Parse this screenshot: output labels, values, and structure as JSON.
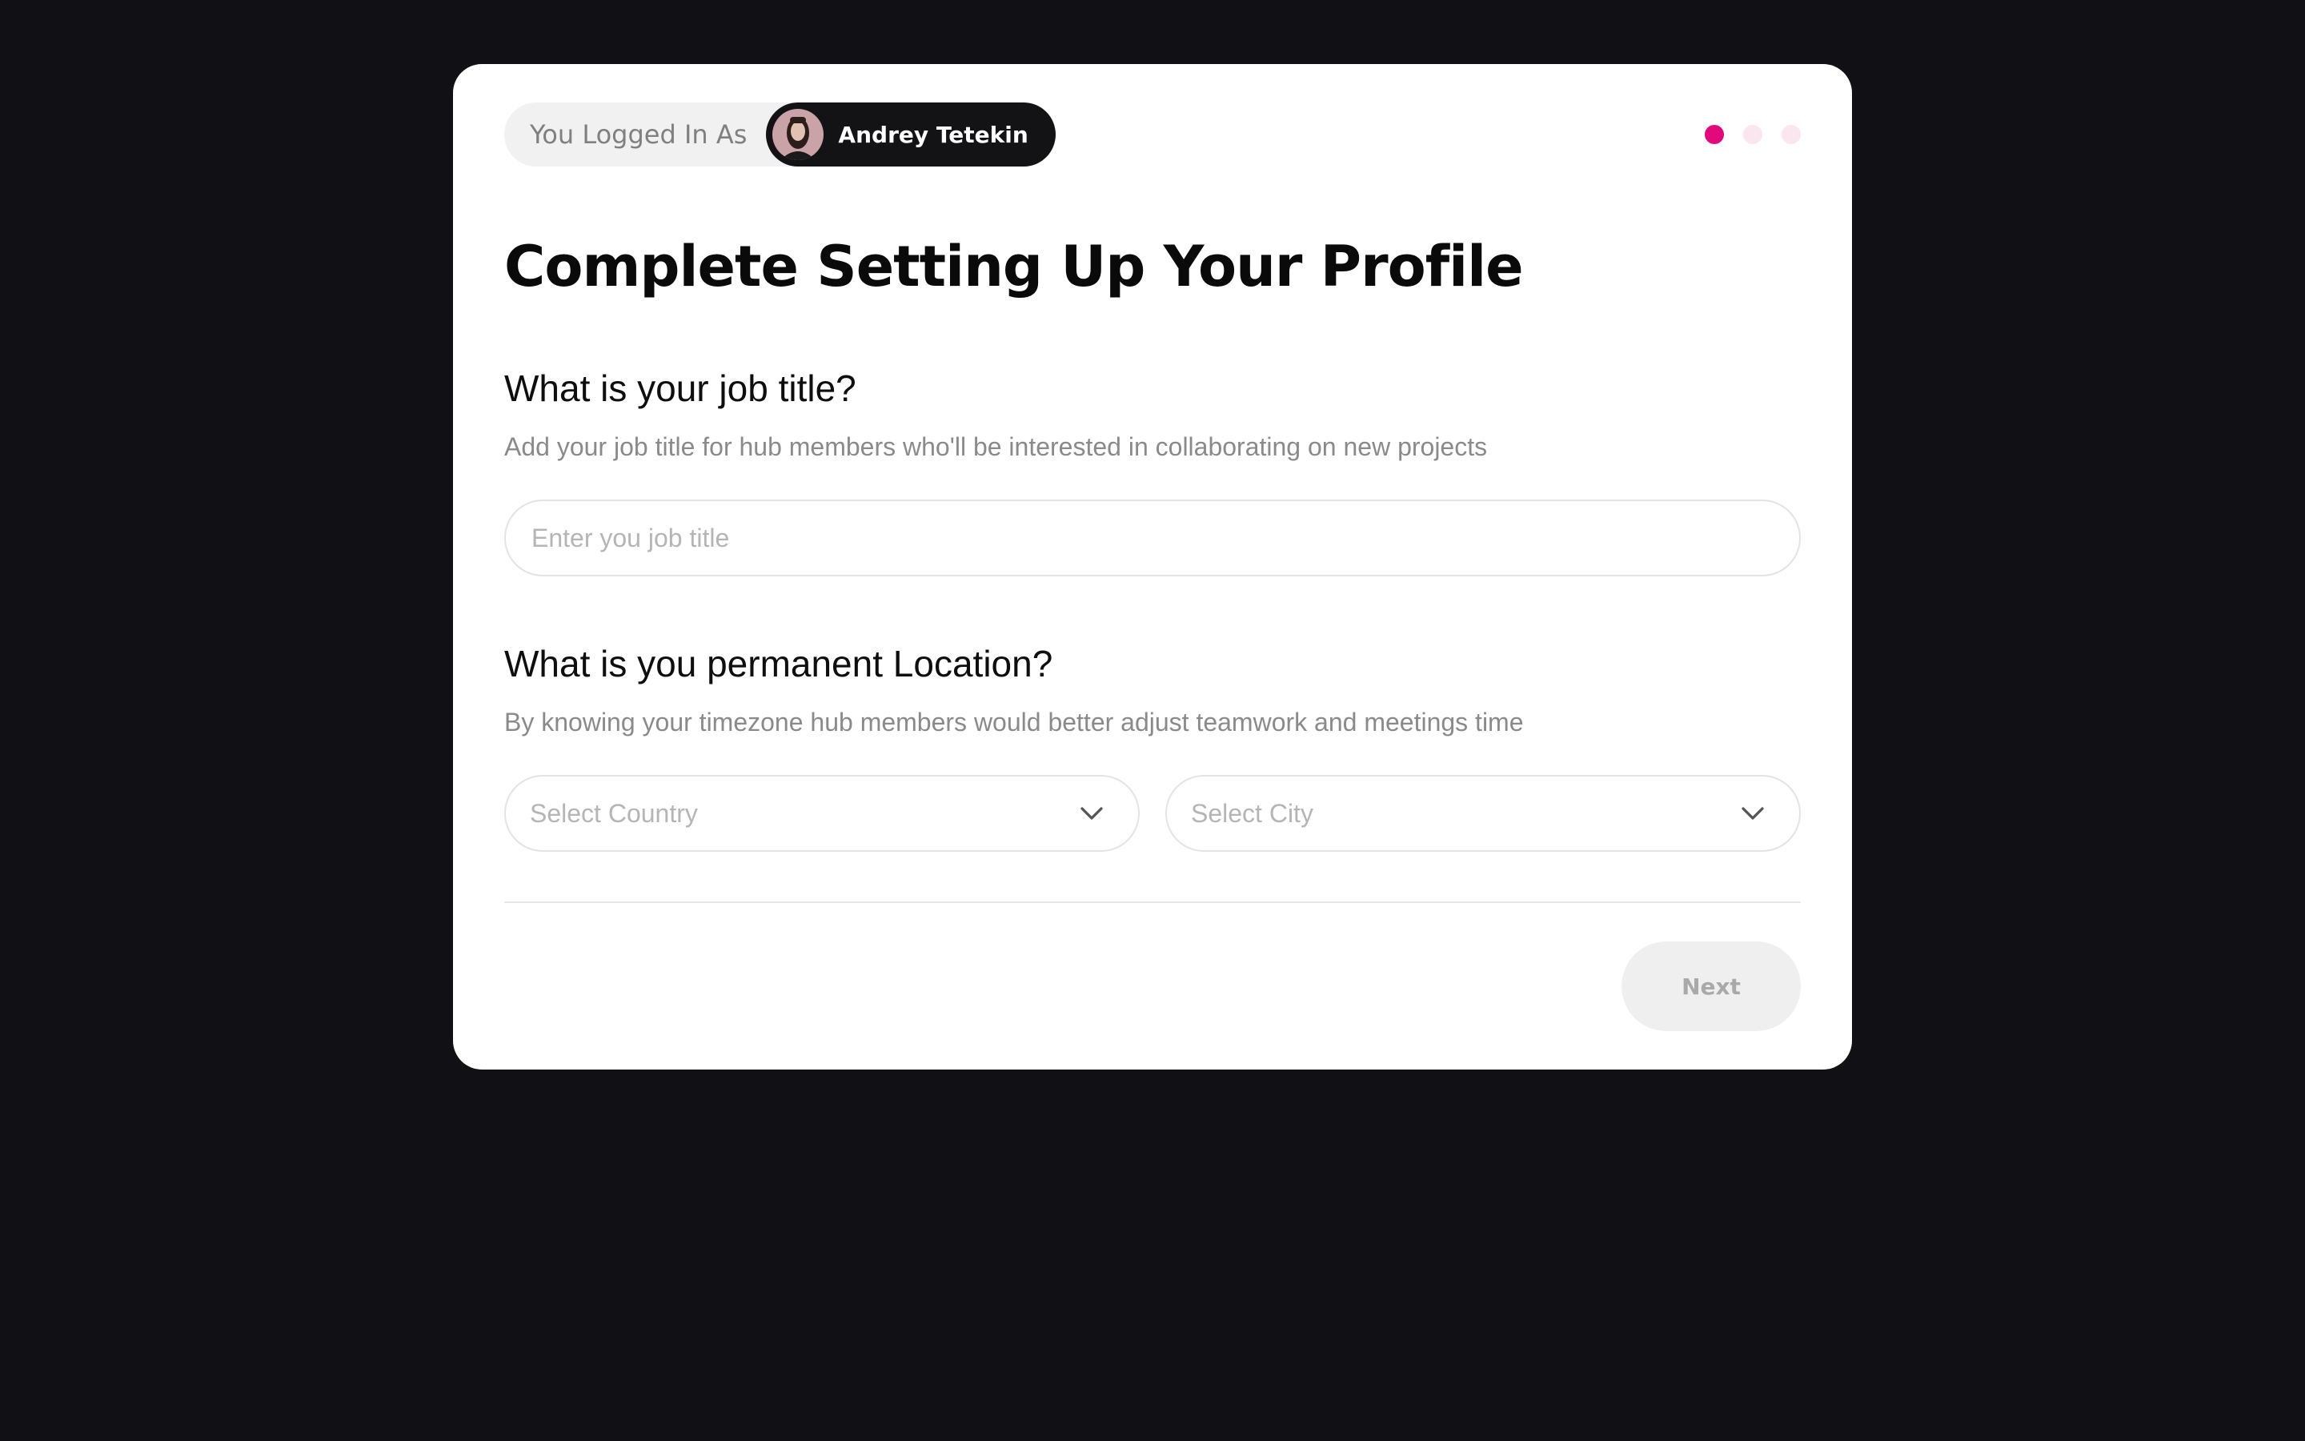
{
  "header": {
    "logged_in_label": "You Logged In As",
    "user_name": "Andrey Tetekin",
    "steps": {
      "total": 3,
      "current": 1
    }
  },
  "page_title": "Complete Setting Up Your Profile",
  "job_section": {
    "title": "What is your job title?",
    "description": "Add your job title for hub members who'll be interested in collaborating on new projects",
    "input_placeholder": "Enter you job title",
    "input_value": ""
  },
  "location_section": {
    "title": "What is you permanent Location?",
    "description": "By knowing your timezone hub members would  better adjust teamwork and meetings time",
    "country_placeholder": "Select Country",
    "city_placeholder": "Select City"
  },
  "footer": {
    "next_label": "Next"
  },
  "colors": {
    "background": "#111015",
    "accent": "#e3097a",
    "step_inactive": "#fbe5ee"
  },
  "icons": {
    "country_dropdown": "chevron-down-icon",
    "city_dropdown": "chevron-down-icon",
    "avatar": "user-avatar"
  }
}
